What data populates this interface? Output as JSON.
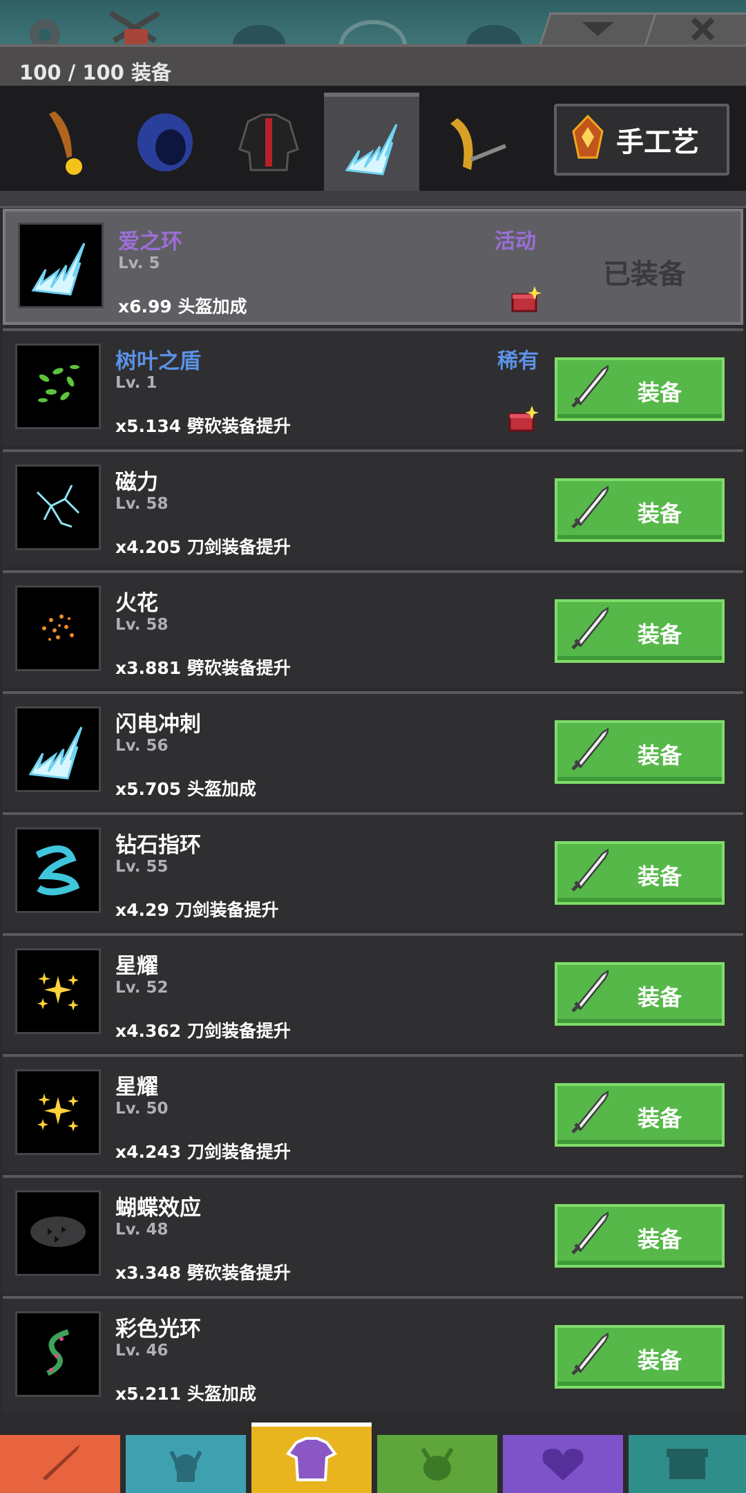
{
  "header": {
    "equip_count": "100 / 100 装备"
  },
  "categories": [
    {
      "id": "weapon",
      "icon": "flame-dagger-icon"
    },
    {
      "id": "helmet",
      "icon": "blue-hood-icon"
    },
    {
      "id": "armor",
      "icon": "black-jacket-icon"
    },
    {
      "id": "aura",
      "icon": "lightning-icon",
      "active": true
    },
    {
      "id": "trail",
      "icon": "gold-slash-icon"
    }
  ],
  "craft_button": {
    "label": "手工艺",
    "icon": "fire-gem-icon"
  },
  "rarity_colors": {
    "event": "#9b6fd6",
    "rare": "#5b92e6",
    "common": "#ffffff"
  },
  "items": [
    {
      "name": "爱之环",
      "level": "Lv. 5",
      "bonus": "x6.99 头盔加成",
      "rarity": "活动",
      "rarity_color": "#9b6fd6",
      "name_color": "#9b6fd6",
      "icon": "lightning-icon",
      "equipped": true,
      "status": "已装备",
      "chest": true
    },
    {
      "name": "树叶之盾",
      "level": "Lv. 1",
      "bonus": "x5.134 劈砍装备提升",
      "rarity": "稀有",
      "rarity_color": "#5b92e6",
      "name_color": "#5b92e6",
      "icon": "leaves-icon",
      "chest": true,
      "button": "装备"
    },
    {
      "name": "磁力",
      "level": "Lv. 58",
      "bonus": "x4.205 刀剑装备提升",
      "icon": "magnet-lightning-icon",
      "button": "装备"
    },
    {
      "name": "火花",
      "level": "Lv. 58",
      "bonus": "x3.881 劈砍装备提升",
      "icon": "sparks-icon",
      "button": "装备"
    },
    {
      "name": "闪电冲刺",
      "level": "Lv. 56",
      "bonus": "x5.705 头盔加成",
      "icon": "lightning-icon",
      "button": "装备"
    },
    {
      "name": "钻石指环",
      "level": "Lv. 55",
      "bonus": "x4.29 刀剑装备提升",
      "icon": "diamond-ring-icon",
      "button": "装备"
    },
    {
      "name": "星耀",
      "level": "Lv. 52",
      "bonus": "x4.362 刀剑装备提升",
      "icon": "stars-icon",
      "button": "装备"
    },
    {
      "name": "星耀",
      "level": "Lv. 50",
      "bonus": "x4.243 刀剑装备提升",
      "icon": "stars-icon",
      "button": "装备"
    },
    {
      "name": "蝴蝶效应",
      "level": "Lv. 48",
      "bonus": "x3.348 劈砍装备提升",
      "icon": "butterflies-icon",
      "button": "装备"
    },
    {
      "name": "彩色光环",
      "level": "Lv. 46",
      "bonus": "x5.211 头盔加成",
      "icon": "rainbow-swirl-icon",
      "button": "装备"
    }
  ],
  "bottom_nav": [
    {
      "id": "weapons",
      "icon": "sword-icon",
      "color": "#e8643f"
    },
    {
      "id": "heroes",
      "icon": "viking-icon",
      "color": "#3fa0b0"
    },
    {
      "id": "equipment",
      "icon": "shirt-icon",
      "color": "#e8b51e",
      "active": true
    },
    {
      "id": "pets",
      "icon": "monster-icon",
      "color": "#5ea53a"
    },
    {
      "id": "guild",
      "icon": "heart-shield-icon",
      "color": "#7e52c8"
    },
    {
      "id": "shop",
      "icon": "chest-icon",
      "color": "#2f8d8a"
    }
  ]
}
